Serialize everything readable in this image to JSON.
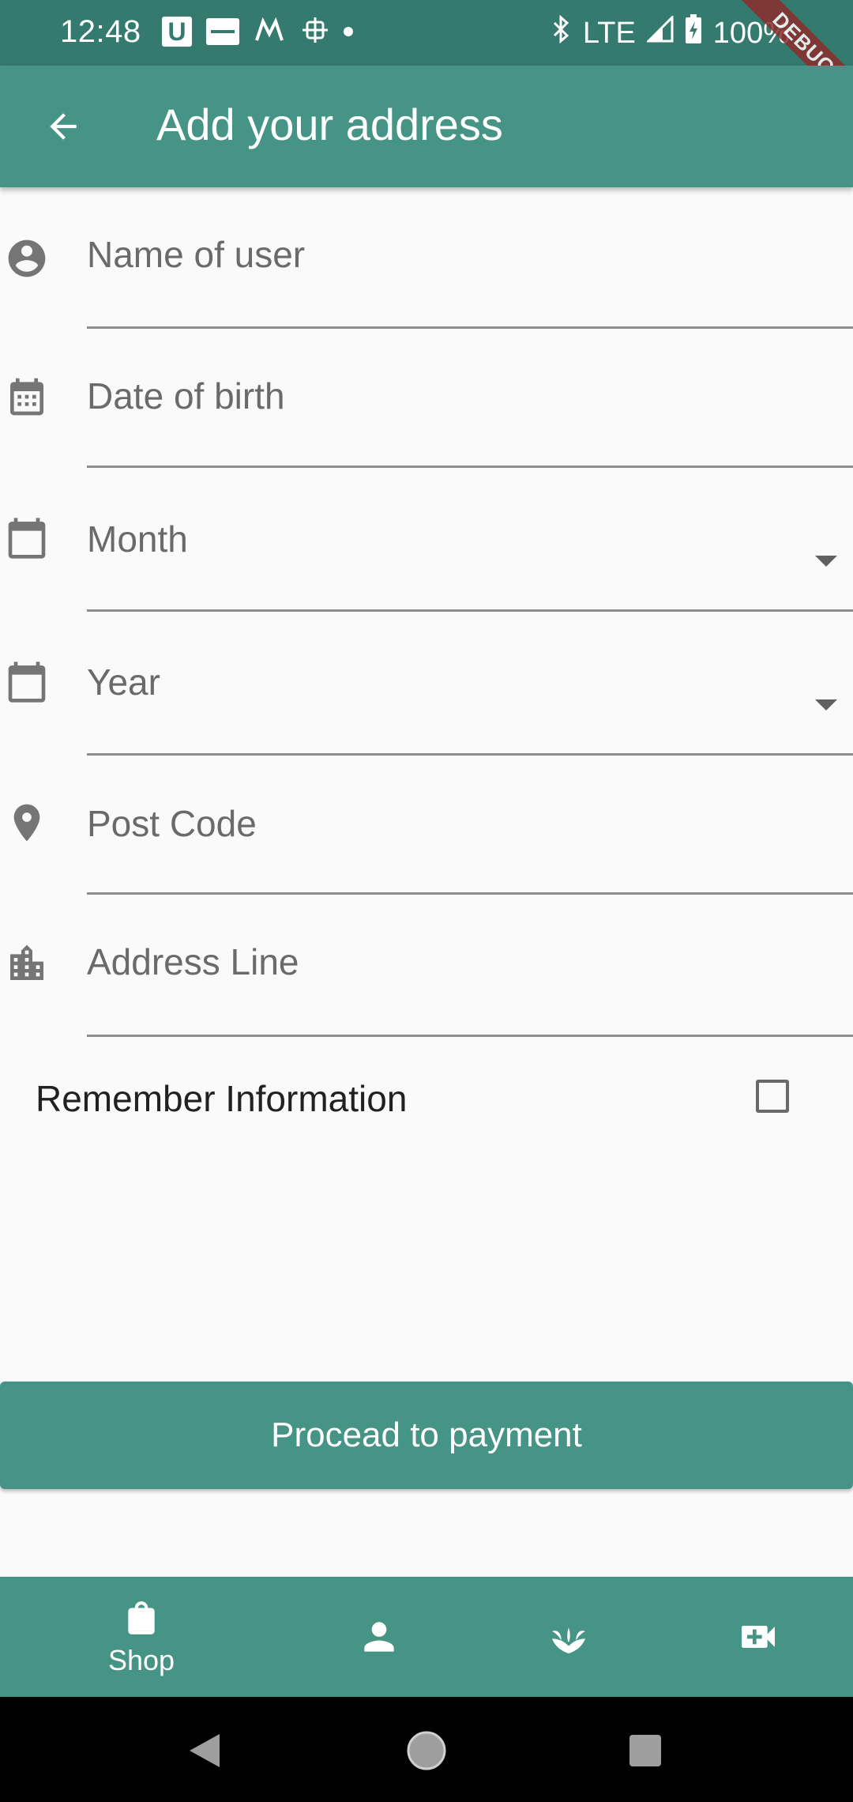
{
  "status_bar": {
    "time": "12:48",
    "network": "LTE",
    "battery": "100%",
    "left_icons": [
      "u-app-icon",
      "zomato-icon",
      "mi-app-icon",
      "network-tower-icon",
      "notification-dot-icon"
    ],
    "right_icons": [
      "bluetooth-icon",
      "signal-icon",
      "battery-charging-icon"
    ]
  },
  "debug_banner": "DEBUG",
  "app_bar": {
    "title": "Add your address",
    "back_icon": "arrow-back-icon"
  },
  "form": {
    "fields": [
      {
        "label": "Name of user",
        "icon": "account-circle-icon",
        "type": "text"
      },
      {
        "label": "Date of birth",
        "icon": "calendar-dots-icon",
        "type": "text"
      },
      {
        "label": "Month",
        "icon": "calendar-icon",
        "type": "dropdown"
      },
      {
        "label": "Year",
        "icon": "calendar-icon",
        "type": "dropdown"
      },
      {
        "label": "Post Code",
        "icon": "location-pin-icon",
        "type": "text"
      },
      {
        "label": "Address Line",
        "icon": "city-icon",
        "type": "text"
      }
    ],
    "remember_label": "Remember Information",
    "remember_checked": false
  },
  "proceed_button": "Procead to payment",
  "bottom_nav": {
    "items": [
      {
        "label": "Shop",
        "icon": "shopping-bag-icon",
        "selected": true
      },
      {
        "label": "",
        "icon": "person-icon",
        "selected": false
      },
      {
        "label": "",
        "icon": "spa-icon",
        "selected": false
      },
      {
        "label": "",
        "icon": "video-call-icon",
        "selected": false
      }
    ]
  },
  "colors": {
    "status_bar": "#357a6e",
    "primary": "#459485",
    "background": "#fafafa",
    "field_label": "#6a6a6a",
    "underline": "#8e8e8e"
  }
}
